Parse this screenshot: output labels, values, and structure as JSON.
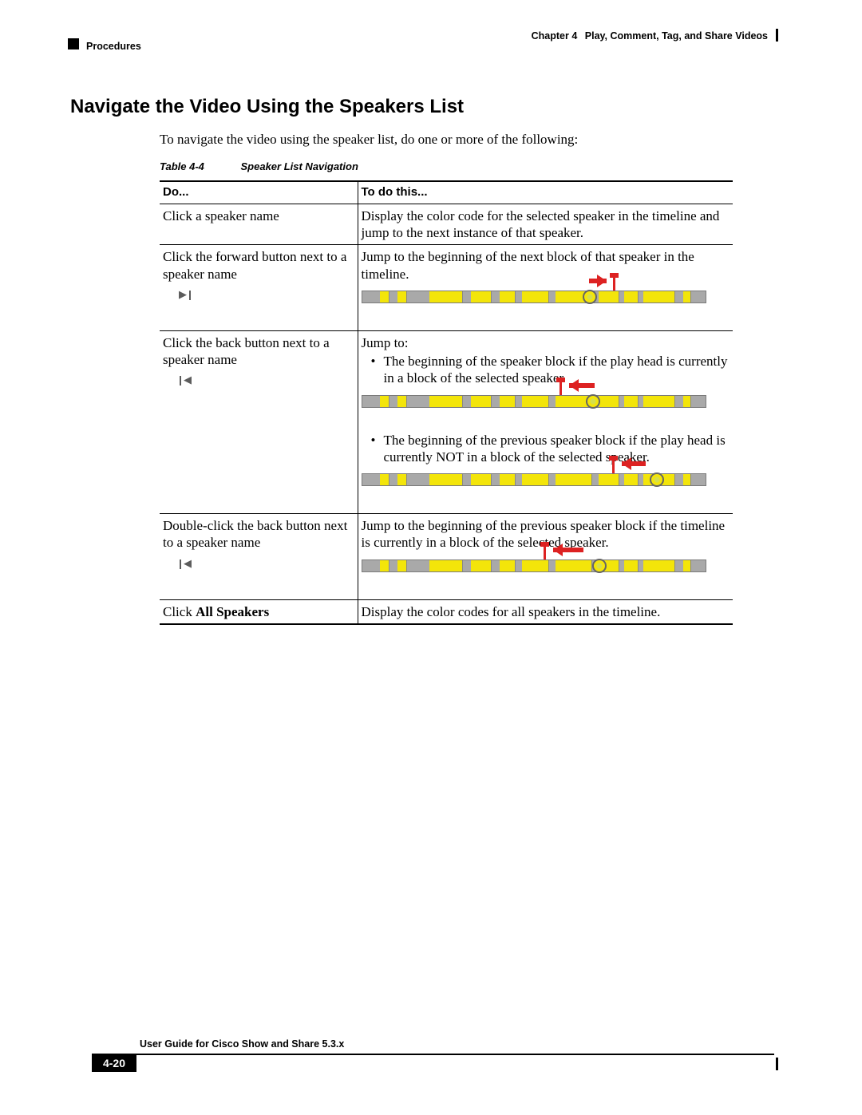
{
  "header": {
    "chapter_label": "Chapter 4",
    "chapter_title": "Play, Comment, Tag, and Share Videos",
    "breadcrumb": "Procedures"
  },
  "section": {
    "title": "Navigate the Video Using the Speakers List",
    "intro": "To navigate the video using the speaker list, do one or more of the following:"
  },
  "table": {
    "caption_num": "Table 4-4",
    "caption_title": "Speaker List Navigation",
    "head_do": "Do...",
    "head_todo": "To do this...",
    "rows": {
      "r1": {
        "do": "Click a speaker name",
        "todo": "Display the color code for the selected speaker in the timeline and jump to the next instance of that speaker."
      },
      "r2": {
        "do": "Click the forward button next to a speaker name",
        "todo": "Jump to the beginning of the next block of that speaker in the timeline."
      },
      "r3": {
        "do": "Click the back button next to a speaker name",
        "todo_lead": "Jump to:",
        "bullet1": "The beginning of the speaker block if the play head is currently in a block of the selected speaker",
        "bullet2": "The beginning of the previous speaker block if the play head is currently NOT in a block of the selected speaker."
      },
      "r4": {
        "do": "Double-click the back button next to a speaker name",
        "todo": "Jump to the beginning of the previous speaker block if the timeline is currently in a block of the selected speaker."
      },
      "r5": {
        "do_pre": "Click ",
        "do_bold": "All Speakers",
        "todo": "Display the color codes for all speakers in the timeline."
      }
    }
  },
  "footer": {
    "guide": "User Guide for Cisco Show and Share 5.3.x",
    "page": "4-20"
  }
}
